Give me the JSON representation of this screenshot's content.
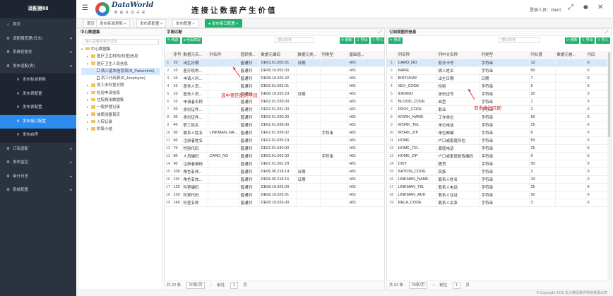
{
  "sidebar": {
    "title": "适配器98",
    "items": [
      {
        "label": "首页",
        "icon": "home-icon",
        "glyph": "⌂",
        "sub": false,
        "active": false,
        "caret": ""
      },
      {
        "label": "适配器管理(日志)",
        "icon": "gear-icon",
        "glyph": "⚙",
        "sub": false,
        "active": false,
        "caret": "▾"
      },
      {
        "label": "系统初始化",
        "icon": "gear-icon",
        "glyph": "⚙",
        "sub": false,
        "active": false,
        "caret": "▸"
      },
      {
        "label": "发布适配(表)",
        "icon": "gear-icon",
        "glyph": "⚙",
        "sub": false,
        "active": false,
        "caret": "▾"
      },
      {
        "label": "发布标准更新",
        "icon": "tools-icon",
        "glyph": "✕",
        "sub": true,
        "active": false,
        "caret": ""
      },
      {
        "label": "发布表配置",
        "icon": "tools-icon",
        "glyph": "✕",
        "sub": true,
        "active": false,
        "caret": ""
      },
      {
        "label": "发布表配置",
        "icon": "tools-icon",
        "glyph": "✕",
        "sub": true,
        "active": false,
        "caret": ""
      },
      {
        "label": "发布接口配置",
        "icon": "tools-icon",
        "glyph": "✕",
        "sub": true,
        "active": true,
        "caret": ""
      },
      {
        "label": "发布启停",
        "icon": "tools-icon",
        "glyph": "✕",
        "sub": true,
        "active": false,
        "caret": ""
      },
      {
        "label": "订阅适配",
        "icon": "gear-icon",
        "glyph": "⚙",
        "sub": false,
        "active": false,
        "caret": "▸"
      },
      {
        "label": "发布监控",
        "icon": "gear-icon",
        "glyph": "⚙",
        "sub": false,
        "active": false,
        "caret": "▸"
      },
      {
        "label": "审计日志",
        "icon": "gear-icon",
        "glyph": "⚙",
        "sub": false,
        "active": false,
        "caret": "▸"
      },
      {
        "label": "系统配置",
        "icon": "gear-icon",
        "glyph": "⚙",
        "sub": false,
        "active": false,
        "caret": "▸"
      }
    ]
  },
  "header": {
    "logo_text": "DataWorld",
    "logo_sub": "数 据 开 创 未 来",
    "slogan": "连接让数据产生价值",
    "user_label": "登录人员：client",
    "icons": [
      "fullscreen-icon",
      "user-icon",
      "close-icon"
    ]
  },
  "tabs": [
    {
      "label": "首页",
      "active": false
    },
    {
      "label": "发布标准更新 ×",
      "active": false
    },
    {
      "label": "发布表配置 ×",
      "active": false
    },
    {
      "label": "发布配置 ×",
      "active": false
    },
    {
      "label": "● 发布接口配置 ×",
      "active": true
    }
  ],
  "tree_panel": {
    "title": "中心数据集",
    "search_placeholder": "输入关键字进行过滤",
    "nodes": [
      {
        "label": "中心数据集",
        "level": 0,
        "toggle": "▾",
        "kind": "folder",
        "selected": false
      },
      {
        "label": "医疗卫生机构(科室)信息",
        "level": 1,
        "toggle": "▸",
        "kind": "folder",
        "selected": false
      },
      {
        "label": "医疗卫生人员信息",
        "level": 1,
        "toggle": "▾",
        "kind": "folder",
        "selected": false
      },
      {
        "label": "病人基本信息表(R_PatientInfo)",
        "level": 2,
        "toggle": "",
        "kind": "file",
        "selected": true
      },
      {
        "label": "员工代码表(R_Employee)",
        "level": 2,
        "toggle": "",
        "kind": "file",
        "selected": false
      },
      {
        "label": "员工多科室对照",
        "level": 1,
        "toggle": "▸",
        "kind": "folder",
        "selected": false
      },
      {
        "label": "检验申请信息",
        "level": 1,
        "toggle": "▸",
        "kind": "folder",
        "selected": false
      },
      {
        "label": "住院费用数据集",
        "level": 1,
        "toggle": "▸",
        "kind": "folder",
        "selected": false
      },
      {
        "label": "一般护理记录",
        "level": 1,
        "toggle": "▸",
        "kind": "folder",
        "selected": false
      },
      {
        "label": "体质测量首页",
        "level": 1,
        "toggle": "▸",
        "kind": "folder",
        "selected": false
      },
      {
        "label": "入院记录",
        "level": 1,
        "toggle": "▸",
        "kind": "folder",
        "selected": false
      },
      {
        "label": "阶段小结",
        "level": 1,
        "toggle": "▸",
        "kind": "folder",
        "selected": false
      }
    ]
  },
  "middle_panel": {
    "title": "字段匹配",
    "btn_edit": "✎ 修改",
    "btn_match": "● 代码匹配",
    "search_placeholder": "搜码实称",
    "btn_refresh": "⟳ 刷新",
    "btn_export": "⇩ 导出",
    "btn_import": "⇧ 导入",
    "columns": [
      "",
      "序号",
      "数据元名...",
      "列名称",
      "值转换...",
      "数据元编码",
      "数据元类...",
      "列类型",
      "基础值..."
    ],
    "rows": [
      [
        "1",
        "10",
        "出生日期",
        "",
        "普通列",
        "DE03.01.005.01",
        "日期",
        "",
        "HIS"
      ],
      [
        "2",
        "10",
        "医疗机构...",
        "",
        "普通列",
        "DE08.10.052.00",
        "",
        "",
        "HIS"
      ],
      [
        "3",
        "10",
        "申请人科...",
        "",
        "普通列",
        "DE08.10.026.32",
        "",
        "",
        "HIS"
      ],
      [
        "4",
        "10",
        "医务人员...",
        "",
        "普通列",
        "DE02.01.062.01",
        "",
        "",
        "HIS"
      ],
      [
        "5",
        "10",
        "医务人员...",
        "",
        "普通列",
        "DE08.10.025.23",
        "日期",
        "",
        "HIS"
      ],
      [
        "6",
        "10",
        "申请者名称",
        "",
        "普通列",
        "DE02.01.039.00",
        "",
        "",
        "HIS"
      ],
      [
        "7",
        "20",
        "身份证件...",
        "",
        "普通列",
        "DE02.01.031.00",
        "",
        "",
        "HIS"
      ],
      [
        "8",
        "30",
        "身份证件...",
        "",
        "普通列",
        "DE02.01.030.00",
        "",
        "",
        "HIS"
      ],
      [
        "9",
        "40",
        "职工姓名",
        "",
        "普通列",
        "DE02.01.039.00",
        "",
        "",
        "HIS"
      ],
      [
        "10",
        "50",
        "联系人姓名",
        "LINKMAN_NA...",
        "普通列",
        "DE02.01.039.02",
        "",
        "字符串",
        "HIS"
      ],
      [
        "11",
        "60",
        "注册者姓名",
        "",
        "普通列",
        "DE02.01.039.19",
        "",
        "",
        "HIS"
      ],
      [
        "12",
        "70",
        "性别代码",
        "",
        "普通列",
        "DE02.01.040.00",
        "",
        "",
        "HIS"
      ],
      [
        "13",
        "80",
        "人员编码",
        "CARD_NO",
        "普通列",
        "DE02.01.062.00",
        "",
        "字符串",
        "HIS"
      ],
      [
        "14",
        "90",
        "注册者编码",
        "",
        "普通列",
        "DE02.01.062.29",
        "",
        "",
        "HIS"
      ],
      [
        "15",
        "100",
        "角色有效...",
        "",
        "普通列",
        "DE06.00.218.14",
        "日期",
        "",
        "HIS"
      ],
      [
        "16",
        "110",
        "角色有效...",
        "",
        "普通列",
        "DE06.00.218.15",
        "日期",
        "",
        "HIS"
      ],
      [
        "17",
        "120",
        "科室编码",
        "",
        "普通列",
        "DE08.10.025.00",
        "",
        "",
        "HIS"
      ],
      [
        "18",
        "130",
        "科室代码",
        "",
        "普通列",
        "DE08.10.025.01",
        "",
        "",
        "HIS"
      ],
      [
        "19",
        "140",
        "科室名称",
        "",
        "普通列",
        "DE08.10.026.00",
        "",
        "",
        "HIS"
      ]
    ],
    "pager": {
      "total": "共 22 条",
      "page_size": "20条/页",
      "goto": "前往",
      "page": "1",
      "unit": "页"
    },
    "annotation": "选中要匹配的字段"
  },
  "right_panel": {
    "title": "订阅视图列信息",
    "search_placeholder": "搜码实称",
    "btn_edit": "✎ 修改",
    "btn_refresh": "⟳ 刷新",
    "btn_export": "⇩ 导出",
    "btn_import": "⇧ 导入",
    "columns": [
      "",
      "列名称",
      "列中文名称",
      "列类型",
      "列长度",
      "数据元格...",
      "代码"
    ],
    "rows": [
      [
        "1",
        "CARD_NO",
        "就诊卡号",
        "字符串",
        "12",
        "",
        "0"
      ],
      [
        "2",
        "NAME",
        "病人姓名",
        "字符串",
        "50",
        "",
        "0"
      ],
      [
        "3",
        "BIRTHDAY",
        "出生日期",
        "日期",
        "7",
        "",
        "0"
      ],
      [
        "4",
        "SEX_CODE",
        "性别",
        "字符串",
        "5",
        "",
        "0"
      ],
      [
        "5",
        "IDENNO",
        "身份证号",
        "字符串",
        "20",
        "",
        "0"
      ],
      [
        "6",
        "BLOOD_CODE",
        "血型",
        "字符串",
        "1",
        "",
        "0"
      ],
      [
        "7",
        "PROF_CODE",
        "职业",
        "字符串",
        "2",
        "",
        "0"
      ],
      [
        "8",
        "WORK_NAME",
        "工作单位",
        "字符串",
        "50",
        "",
        "0"
      ],
      [
        "9",
        "WORK_TEL",
        "单位电话",
        "字符串",
        "25",
        "",
        "0"
      ],
      [
        "10",
        "WORK_ZIP",
        "单位邮编",
        "字符串",
        "6",
        "",
        "0"
      ],
      [
        "11",
        "HOME",
        "户口或家庭所在",
        "字符串",
        "50",
        "",
        "0"
      ],
      [
        "12",
        "HOME_TEL",
        "家庭电话",
        "字符串",
        "25",
        "",
        "0"
      ],
      [
        "13",
        "HOME_ZIP",
        "户口或家庭邮政编码",
        "字符串",
        "6",
        "",
        "0"
      ],
      [
        "14",
        "DIST",
        "籍贯",
        "字符串",
        "50",
        "",
        "0"
      ],
      [
        "15",
        "NATION_CODE",
        "民族",
        "字符串",
        "2",
        "",
        "0"
      ],
      [
        "16",
        "LINKMAN_NAME",
        "联系人姓名",
        "字符串",
        "10",
        "",
        "0"
      ],
      [
        "17",
        "LINKMAN_TEL",
        "联系人电话",
        "字符串",
        "25",
        "",
        "0"
      ],
      [
        "18",
        "LINKMAN_ADD",
        "联系人住址",
        "字符串",
        "50",
        "",
        "0"
      ],
      [
        "19",
        "RELA_CODE",
        "联系人关系",
        "字符串",
        "3",
        "",
        "0"
      ]
    ],
    "pager": {
      "total": "共 62 条",
      "page_size": "20条/页",
      "goto": "前往",
      "page": "1",
      "unit": "页"
    },
    "annotation": "双击进行匹配"
  },
  "footer": "© Copyright 2016 长沙德讯软件科技有限公司"
}
